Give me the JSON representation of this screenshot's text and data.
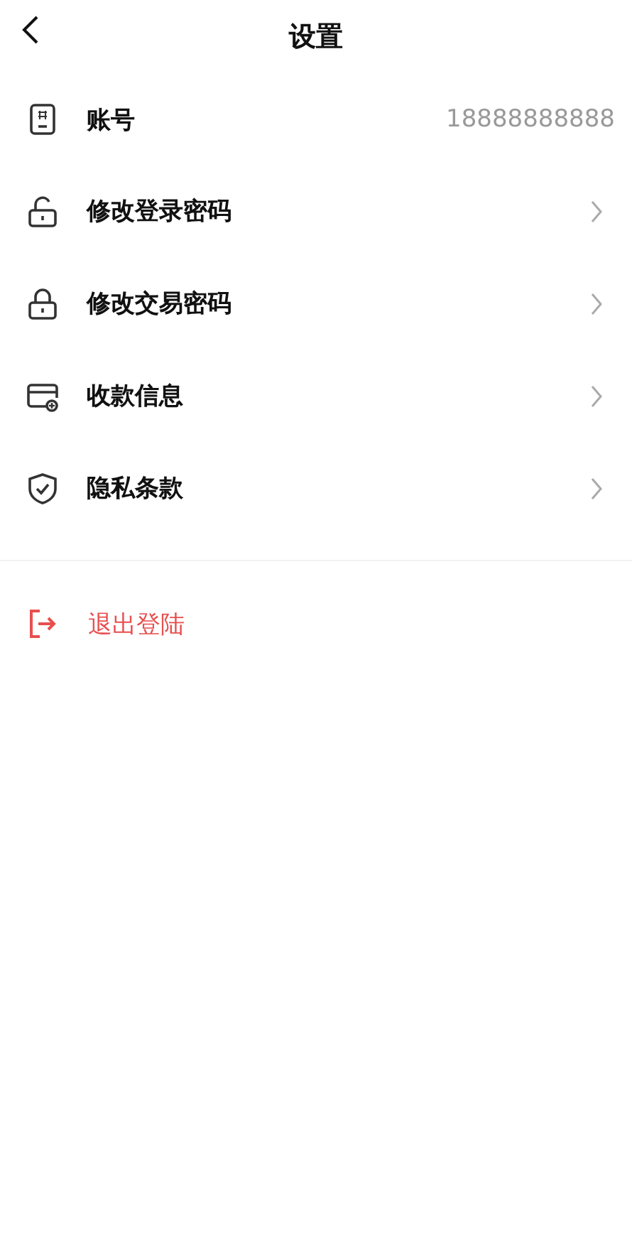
{
  "header": {
    "title": "设置"
  },
  "items": [
    {
      "kind": "value",
      "label": "账号",
      "value": "18888888888"
    },
    {
      "kind": "link",
      "label": "修改登录密码"
    },
    {
      "kind": "link",
      "label": "修改交易密码"
    },
    {
      "kind": "link",
      "label": "收款信息"
    },
    {
      "kind": "link",
      "label": "隐私条款"
    }
  ],
  "logout": {
    "label": "退出登陆"
  }
}
